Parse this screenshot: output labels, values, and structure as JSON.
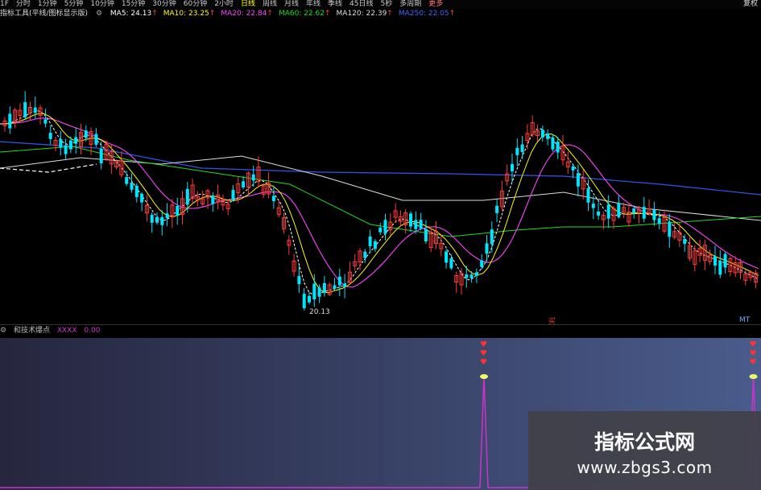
{
  "toolbar": {
    "items": [
      "1F",
      "分时",
      "1分钟",
      "5分钟",
      "10分钟",
      "15分钟",
      "30分钟",
      "60分钟",
      "2小时",
      "日线",
      "周线",
      "月线",
      "年线",
      "季线",
      "45日线",
      "5秒",
      "多周期",
      "更多"
    ],
    "active_index": 9,
    "right_button": "复权"
  },
  "ma_legend": {
    "title": "指标工具(平线/图标显示版)",
    "items": [
      {
        "label": "MA5: 24.13",
        "color": "#ffffff"
      },
      {
        "label": "MA10: 23.25",
        "color": "#ffff00"
      },
      {
        "label": "MA20: 22.84",
        "color": "#ff44ff"
      },
      {
        "label": "MA60: 22.62",
        "color": "#22dd22"
      },
      {
        "label": "MA120: 22.39",
        "color": "#dddddd"
      },
      {
        "label": "MA250: 22.05",
        "color": "#4466ff"
      }
    ]
  },
  "chart": {
    "low_label": "20.13",
    "mark_left": "买",
    "mark_right": "MT"
  },
  "indicator": {
    "name": "和技术爆点",
    "value_name": "XXXX",
    "value": "0.00",
    "value_color": "#cc33cc",
    "signal_positions": [
      0.636,
      0.99
    ]
  },
  "watermark": {
    "title": "指标公式网",
    "url": "www.zbgs3.com"
  },
  "colors": {
    "up": "#ff3b3b",
    "down": "#00e5ff",
    "ma5": "#ffffff",
    "ma10": "#ffff00",
    "ma20": "#ff44ff",
    "ma60": "#22dd22",
    "ma120": "#dddddd",
    "ma250": "#3355ee"
  }
}
